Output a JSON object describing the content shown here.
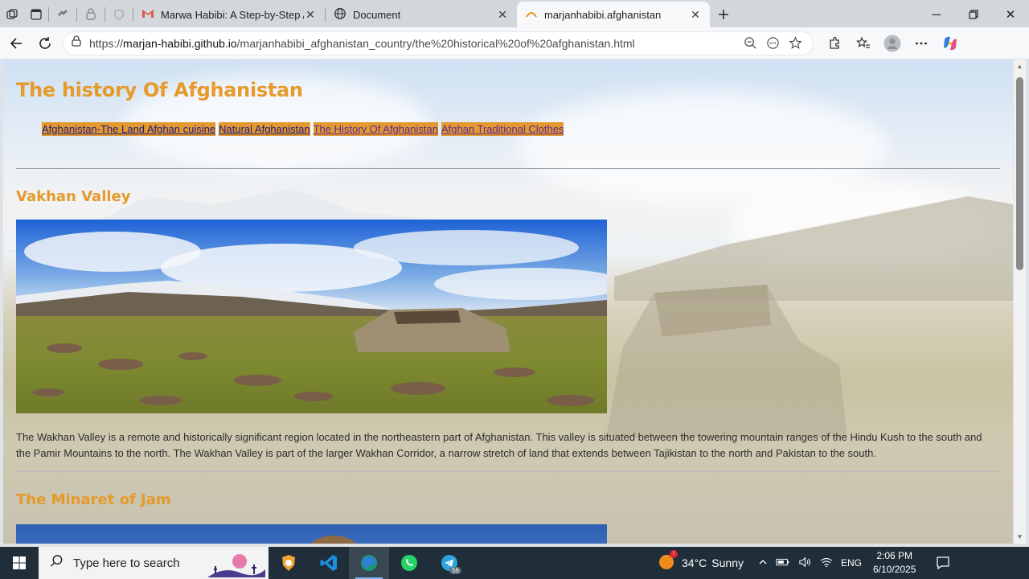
{
  "browser": {
    "tabs": [
      {
        "title": "Marwa Habibi: A Step-by-Step AI",
        "icon": "gmail-icon"
      },
      {
        "title": "Document",
        "icon": "globe-icon"
      },
      {
        "title": "marjanhabibi.afghanistan",
        "icon": "site-icon",
        "active": true
      }
    ],
    "url_prefix": "https://",
    "url_host": "marjan-habibi.github.io",
    "url_path": "/marjanhabibi_afghanistan_country/the%20historical%20of%20afghanistan.html"
  },
  "page": {
    "title": "The history Of Afghanistan",
    "nav": [
      "Afghanistan-The Land Afghan cuisine",
      "Natural Afghanistan",
      "The History Of Afghanistan",
      "Afghan Traditional Clothes"
    ],
    "sections": [
      {
        "heading": "Vakhan Valley",
        "text": "The Wakhan Valley is a remote and historically significant region located in the northeastern part of Afghanistan. This valley is situated between the towering mountain ranges of the Hindu Kush to the south and the Pamir Mountains to the north. The Wakhan Valley is part of the larger Wakhan Corridor, a narrow stretch of land that extends between Tajikistan to the north and Pakistan to the south."
      },
      {
        "heading": "The Minaret of Jam"
      }
    ]
  },
  "taskbar": {
    "search_placeholder": "Type here to search",
    "weather_temp": "34°C",
    "weather_text": "Sunny",
    "language": "ENG",
    "time": "2:06 PM",
    "date": "6/10/2025",
    "telegram_badge": "56"
  },
  "colors": {
    "accent": "#e59a2a",
    "nav_bg": "#e4992e",
    "taskbar": "#1f2e38"
  }
}
